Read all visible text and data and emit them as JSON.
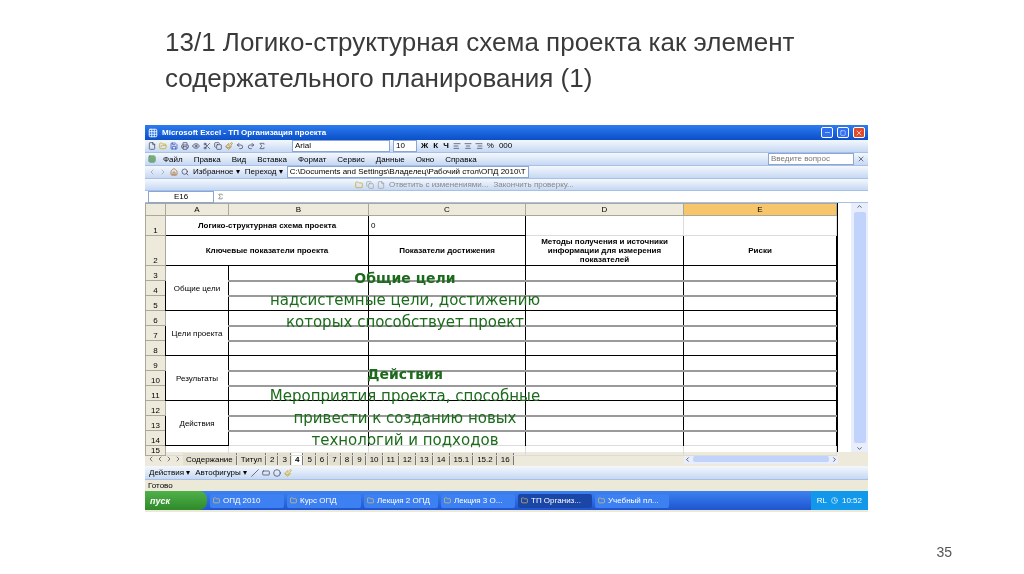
{
  "slide": {
    "title_lines": [
      "13/1 Логико-структурная схема проекта как элемент",
      "содержательного планирования (1)"
    ],
    "page_number": "35"
  },
  "window": {
    "title": "Microsoft Excel - ТП Организация проекта"
  },
  "toolbar": {
    "font": "Arial",
    "size": "10",
    "format_buttons": [
      "Ж",
      "К",
      "Ч"
    ],
    "number_buttons": [
      "%",
      "000"
    ]
  },
  "menu": {
    "items": [
      "Файл",
      "Правка",
      "Вид",
      "Вставка",
      "Формат",
      "Сервис",
      "Данные",
      "Окно",
      "Справка"
    ],
    "help_placeholder": "Введите вопрос"
  },
  "web_toolbar": {
    "favorites": "Избранное ▾",
    "go": "Переход ▾",
    "address": "C:\\Documents and Settings\\Владелец\\Рабочий стол\\ОПД 2010\\Т"
  },
  "review_toolbar": {
    "reply": "Ответить с изменениями...",
    "end": "Закончить проверку..."
  },
  "formula_bar": {
    "name_box": "E16"
  },
  "sheet": {
    "columns": [
      {
        "label": "A",
        "selected": false
      },
      {
        "label": "B",
        "selected": false
      },
      {
        "label": "C",
        "selected": false
      },
      {
        "label": "D",
        "selected": false
      },
      {
        "label": "E",
        "selected": true
      }
    ],
    "rows": [
      "1",
      "2",
      "3",
      "4",
      "5",
      "6",
      "7",
      "8",
      "9",
      "10",
      "11",
      "12",
      "13",
      "14",
      "15"
    ],
    "title": "Логико-структурная схема проекта",
    "title_value": "0",
    "headers": [
      "Ключевые показатели проекта",
      "Показатели достижения",
      "Методы получения и источники информации для измерения показателей",
      "Риски"
    ],
    "groups": [
      "Общие цели",
      "Цели проекта",
      "Результаты",
      "Действия"
    ]
  },
  "overlays": [
    {
      "heading": "Общие цели",
      "lines": [
        "надсистемные цели,  достижению",
        "которых способствует проект"
      ]
    },
    {
      "heading": "Действия",
      "lines": [
        "Мероприятия проекта, способные",
        "привести к созданию новых",
        "технологий и подходов"
      ]
    }
  ],
  "sheet_tabs": [
    {
      "label": "Содержание",
      "selected": false
    },
    {
      "label": "Титул",
      "selected": false
    },
    {
      "label": "2",
      "selected": false
    },
    {
      "label": "3",
      "selected": false
    },
    {
      "label": "4",
      "selected": true
    },
    {
      "label": "5",
      "selected": false
    },
    {
      "label": "6",
      "selected": false
    },
    {
      "label": "7",
      "selected": false
    },
    {
      "label": "8",
      "selected": false
    },
    {
      "label": "9",
      "selected": false
    },
    {
      "label": "10",
      "selected": false
    },
    {
      "label": "11",
      "selected": false
    },
    {
      "label": "12",
      "selected": false
    },
    {
      "label": "13",
      "selected": false
    },
    {
      "label": "14",
      "selected": false
    },
    {
      "label": "15.1",
      "selected": false
    },
    {
      "label": "15.2",
      "selected": false
    },
    {
      "label": "16",
      "selected": false
    }
  ],
  "drawing_toolbar": {
    "actions": "Действия ▾",
    "autoshapes": "Автофигуры ▾"
  },
  "status": "Готово",
  "taskbar": {
    "start": "пуск",
    "items": [
      {
        "label": "ОПД 2010",
        "selected": false
      },
      {
        "label": "Курс ОПД",
        "selected": false
      },
      {
        "label": "Лекция 2 ОПД",
        "selected": false
      },
      {
        "label": "Лекция 3 О...",
        "selected": false
      },
      {
        "label": "ТП Организ...",
        "selected": true
      },
      {
        "label": "Учебный пл...",
        "selected": false
      }
    ],
    "language": "RL",
    "clock": "10:52"
  }
}
